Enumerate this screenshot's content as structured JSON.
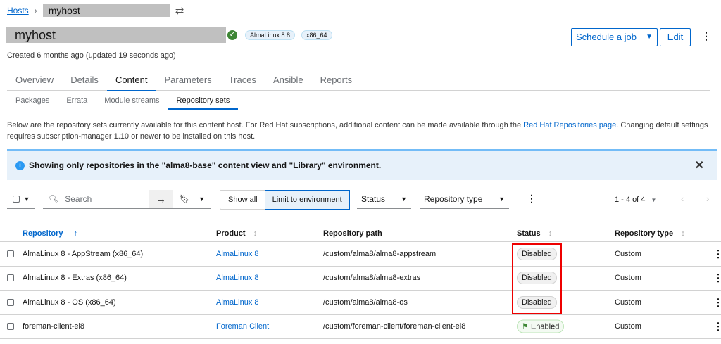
{
  "breadcrumb": {
    "root": "Hosts",
    "current": "myhost"
  },
  "header": {
    "title": "myhost",
    "os_badge": "AlmaLinux 8.8",
    "arch_badge": "x86_64",
    "created": "Created 6 months ago (updated 19 seconds ago)",
    "schedule_label": "Schedule a job",
    "edit_label": "Edit"
  },
  "tabs": [
    "Overview",
    "Details",
    "Content",
    "Parameters",
    "Traces",
    "Ansible",
    "Reports"
  ],
  "subtabs": [
    "Packages",
    "Errata",
    "Module streams",
    "Repository sets"
  ],
  "description": {
    "before": "Below are the repository sets currently available for this content host. For Red Hat subscriptions, additional content can be made available through the ",
    "link": "Red Hat Repositories page",
    "after": ". Changing default settings requires subscription-manager 1.10 or newer to be installed on this host."
  },
  "alert": "Showing only repositories in the \"alma8-base\" content view and \"Library\" environment.",
  "toolbar": {
    "search_placeholder": "Search",
    "show_all": "Show all",
    "limit_env": "Limit to environment",
    "status": "Status",
    "repo_type": "Repository type",
    "pagination": "1 - 4 of 4"
  },
  "columns": [
    "Repository",
    "Product",
    "Repository path",
    "Status",
    "Repository type"
  ],
  "rows": [
    {
      "repo": "AlmaLinux 8 - AppStream (x86_64)",
      "product": "AlmaLinux 8",
      "path": "/custom/alma8/alma8-appstream",
      "status": "Disabled",
      "type": "Custom"
    },
    {
      "repo": "AlmaLinux 8 - Extras (x86_64)",
      "product": "AlmaLinux 8",
      "path": "/custom/alma8/alma8-extras",
      "status": "Disabled",
      "type": "Custom"
    },
    {
      "repo": "AlmaLinux 8 - OS (x86_64)",
      "product": "AlmaLinux 8",
      "path": "/custom/alma8/alma8-os",
      "status": "Disabled",
      "type": "Custom"
    },
    {
      "repo": "foreman-client-el8",
      "product": "Foreman Client",
      "path": "/custom/foreman-client/foreman-client-el8",
      "status": "Enabled",
      "type": "Custom"
    }
  ]
}
